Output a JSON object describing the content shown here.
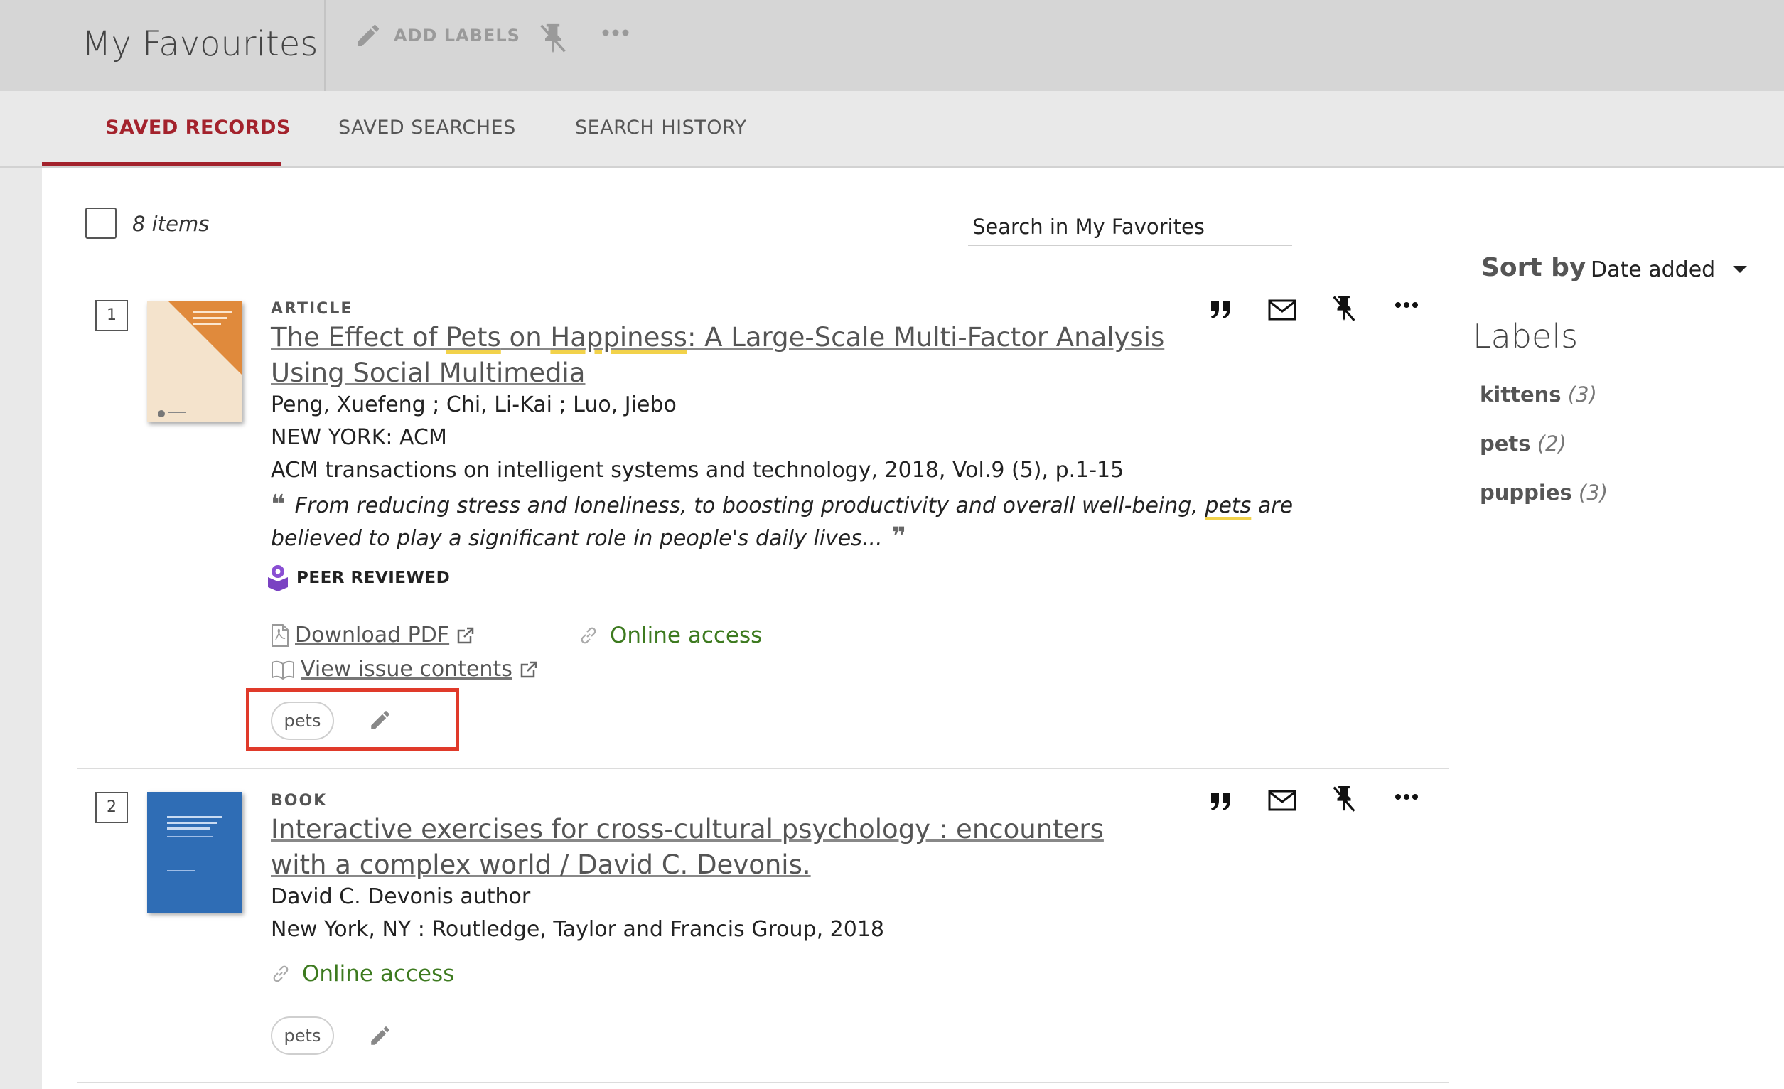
{
  "header": {
    "title": "My Favourites",
    "add_labels": "ADD LABELS",
    "unpin_icon": "unpin-icon",
    "more_icon": "more-icon"
  },
  "tabs": [
    {
      "label": "SAVED RECORDS",
      "active": true
    },
    {
      "label": "SAVED SEARCHES",
      "active": false
    },
    {
      "label": "SEARCH HISTORY",
      "active": false
    }
  ],
  "toolbar": {
    "items_count": "8 items",
    "search_placeholder": "Search in My Favorites"
  },
  "sidebar": {
    "sort_label": "Sort by",
    "sort_value": "Date added",
    "labels_heading": "Labels",
    "labels": [
      {
        "name": "kittens",
        "count": "(3)"
      },
      {
        "name": "pets",
        "count": "(2)"
      },
      {
        "name": "puppies",
        "count": "(3)"
      }
    ]
  },
  "records": [
    {
      "number": "1",
      "type": "ARTICLE",
      "title_parts": [
        "The Effect of ",
        "Pets",
        " on ",
        "Happiness",
        ": A Large-Scale Multi-Factor Analysis Using Social Multimedia"
      ],
      "authors": "Peng, Xuefeng ; Chi, Li-Kai ; Luo, Jiebo",
      "publisher": "NEW YORK: ACM",
      "source": "ACM transactions on intelligent systems and technology, 2018, Vol.9 (5), p.1-15",
      "snippet_parts": [
        "From reducing stress and loneliness, to boosting productivity and overall well-being, ",
        "pets",
        " are believed to play a significant role in people's daily lives..."
      ],
      "peer_reviewed": "PEER REVIEWED",
      "download_pdf": "Download PDF",
      "view_issue": "View issue contents",
      "online_access": "Online access",
      "label": "pets",
      "thumb_color": "#f4e3cc",
      "thumb_accent": "#e08a3c"
    },
    {
      "number": "2",
      "type": "BOOK",
      "title": "Interactive exercises for cross-cultural psychology : encounters with a complex world / David C. Devonis.",
      "authors": "David C. Devonis author",
      "publisher": "New York, NY : Routledge, Taylor and Francis Group, 2018",
      "online_access": "Online access",
      "label": "pets",
      "thumb_color": "#2f6db5"
    }
  ],
  "colors": {
    "accent": "#a3222c",
    "online": "#3d7a1f",
    "highlight": "#f2d24a",
    "annotation_box": "#e03a2a"
  }
}
